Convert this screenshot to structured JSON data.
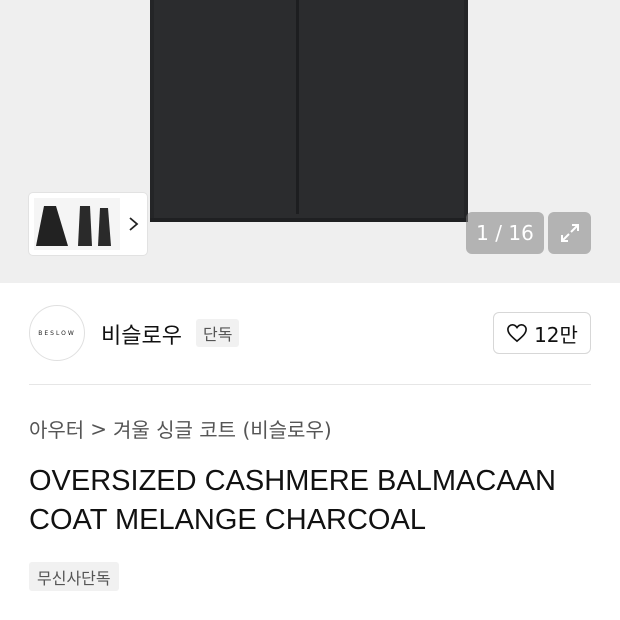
{
  "gallery": {
    "counter": "1 / 16"
  },
  "brand": {
    "logo_text": "BESLOW",
    "name": "비슬로우",
    "badge": "단독"
  },
  "like": {
    "count": "12만"
  },
  "breadcrumb": {
    "category": "아우터",
    "separator": ">",
    "subcategory": "겨울 싱글 코트 (비슬로우)"
  },
  "product": {
    "title": "OVERSIZED CASHMERE BALMACAAN COAT MELANGE CHARCOAL",
    "tag": "무신사단독"
  },
  "colors": {
    "coat": "#2b2c2e",
    "hero_bg": "#efefef"
  }
}
